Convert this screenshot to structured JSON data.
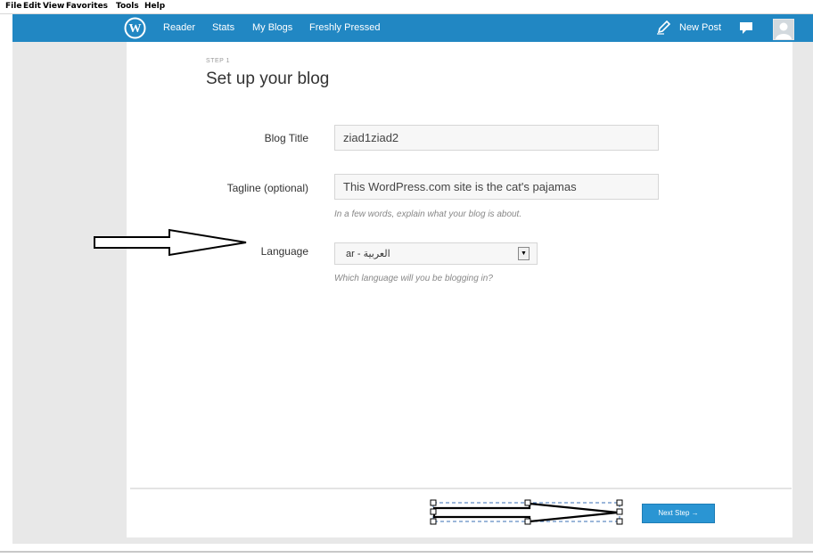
{
  "menubar": {
    "items": [
      "File",
      "Edit",
      "View",
      "Favorites",
      "Tools",
      "Help"
    ]
  },
  "wpbar": {
    "logo_icon": "wordpress-logo-icon",
    "nav": [
      "Reader",
      "Stats",
      "My Blogs",
      "Freshly Pressed"
    ],
    "new_post": "New Post",
    "new_post_icon": "pencil-icon",
    "notifications_icon": "speech-bubble-icon",
    "avatar_icon": "user-avatar-icon",
    "color": "#2187c3"
  },
  "setup": {
    "step": "STEP 1",
    "title": "Set up your blog",
    "blog_title_label": "Blog Title",
    "blog_title_value": "ziad1ziad2",
    "tagline_label": "Tagline (optional)",
    "tagline_value": "This WordPress.com site is the cat's pajamas",
    "tagline_hint": "In a few words, explain what your blog is about.",
    "language_label": "Language",
    "language_value": "ar - العربية",
    "language_hint": "Which language will you be blogging in?"
  },
  "footer": {
    "next_button": "Next Step →",
    "button_color": "#2a95d3"
  },
  "annotations": {
    "arrow_icon": "right-arrow-icon"
  }
}
